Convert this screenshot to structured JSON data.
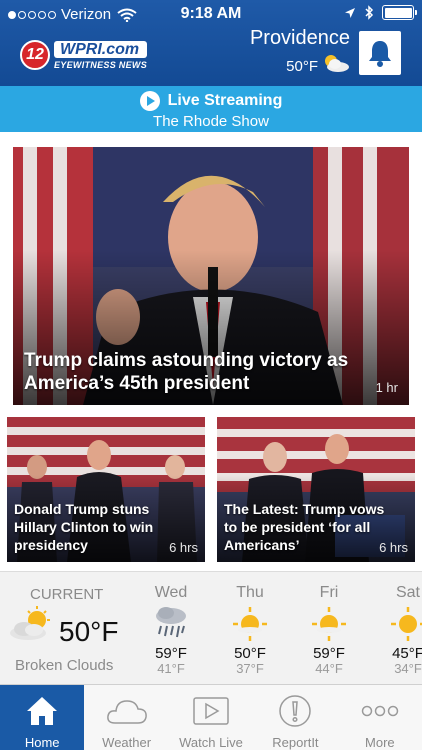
{
  "status_bar": {
    "carrier": "Verizon",
    "time": "9:18 AM",
    "battery_level": 1.0
  },
  "header": {
    "logo_number": "12",
    "logo_brand": "WPRI.com",
    "logo_tagline": "EYEWITNESS NEWS",
    "city": "Providence",
    "temperature": "50°F",
    "weather_icon": "partly-cloudy-icon",
    "alert_icon": "bell-icon"
  },
  "live_bar": {
    "title": "Live Streaming",
    "subtitle": "The Rhode Show"
  },
  "stories": {
    "main": {
      "headline": "Trump claims astounding victory as America’s 45th president",
      "age": "1 hr"
    },
    "left": {
      "headline": "Donald Trump stuns Hillary Clinton to win presidency",
      "age": "6 hrs"
    },
    "right": {
      "headline": "The Latest: Trump vows to be president ‘for all Americans’",
      "age": "6 hrs"
    }
  },
  "weather": {
    "current_label": "CURRENT",
    "current_temp": "50°F",
    "current_condition": "Broken Clouds",
    "current_icon": "partly-cloudy-icon",
    "forecast": [
      {
        "day": "Wed",
        "high": "59°F",
        "low": "41°F",
        "icon": "rain-icon"
      },
      {
        "day": "Thu",
        "high": "50°F",
        "low": "37°F",
        "icon": "sun-icon"
      },
      {
        "day": "Fri",
        "high": "59°F",
        "low": "44°F",
        "icon": "sun-icon"
      },
      {
        "day": "Sat",
        "high": "45°F",
        "low": "34°F",
        "icon": "sun-icon"
      }
    ]
  },
  "tabs": [
    {
      "label": "Home",
      "icon": "home-icon",
      "active": true
    },
    {
      "label": "Weather",
      "icon": "cloud-icon",
      "active": false
    },
    {
      "label": "Watch Live",
      "icon": "play-icon",
      "active": false
    },
    {
      "label": "ReportIt",
      "icon": "alert-icon",
      "active": false
    },
    {
      "label": "More",
      "icon": "more-icon",
      "active": false
    }
  ],
  "colors": {
    "header_blue": "#134a94",
    "live_blue": "#2ba7e2",
    "active_tab": "#1a5aa6"
  }
}
